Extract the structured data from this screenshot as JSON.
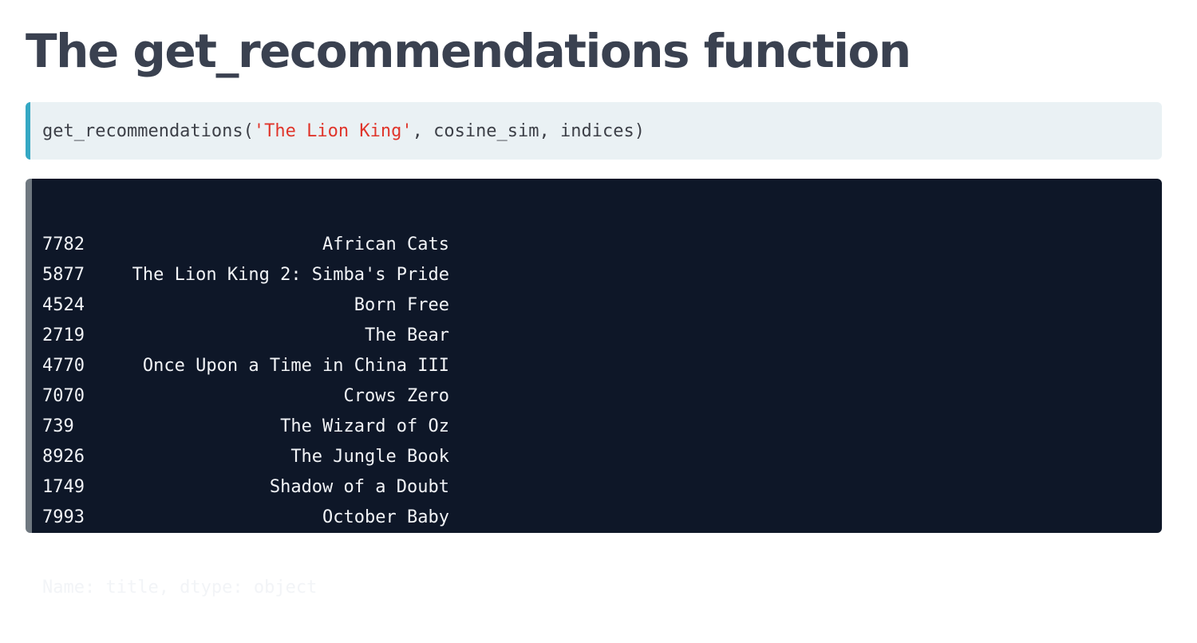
{
  "slide": {
    "title": "The get_recommendations function"
  },
  "code_input": {
    "before_string": "get_recommendations(",
    "string_literal": "'The Lion King'",
    "after_string": ", cosine_sim, indices)"
  },
  "code_output": {
    "rows": [
      {
        "index": "7782",
        "title": "African Cats"
      },
      {
        "index": "5877",
        "title": "The Lion King 2: Simba's Pride"
      },
      {
        "index": "4524",
        "title": "Born Free"
      },
      {
        "index": "2719",
        "title": "The Bear"
      },
      {
        "index": "4770",
        "title": "Once Upon a Time in China III"
      },
      {
        "index": "7070",
        "title": "Crows Zero"
      },
      {
        "index": "739",
        "title": "The Wizard of Oz"
      },
      {
        "index": "8926",
        "title": "The Jungle Book"
      },
      {
        "index": "1749",
        "title": "Shadow of a Doubt"
      },
      {
        "index": "7993",
        "title": "October Baby"
      }
    ],
    "footer": "Name: title, dtype: object"
  },
  "colors": {
    "title_text": "#3a4150",
    "input_bg": "#eaf1f4",
    "input_accent": "#35a8c4",
    "string_literal": "#e0352b",
    "output_bg": "#0e1728",
    "output_accent": "#6f7880",
    "output_text": "#f2f4f7"
  }
}
